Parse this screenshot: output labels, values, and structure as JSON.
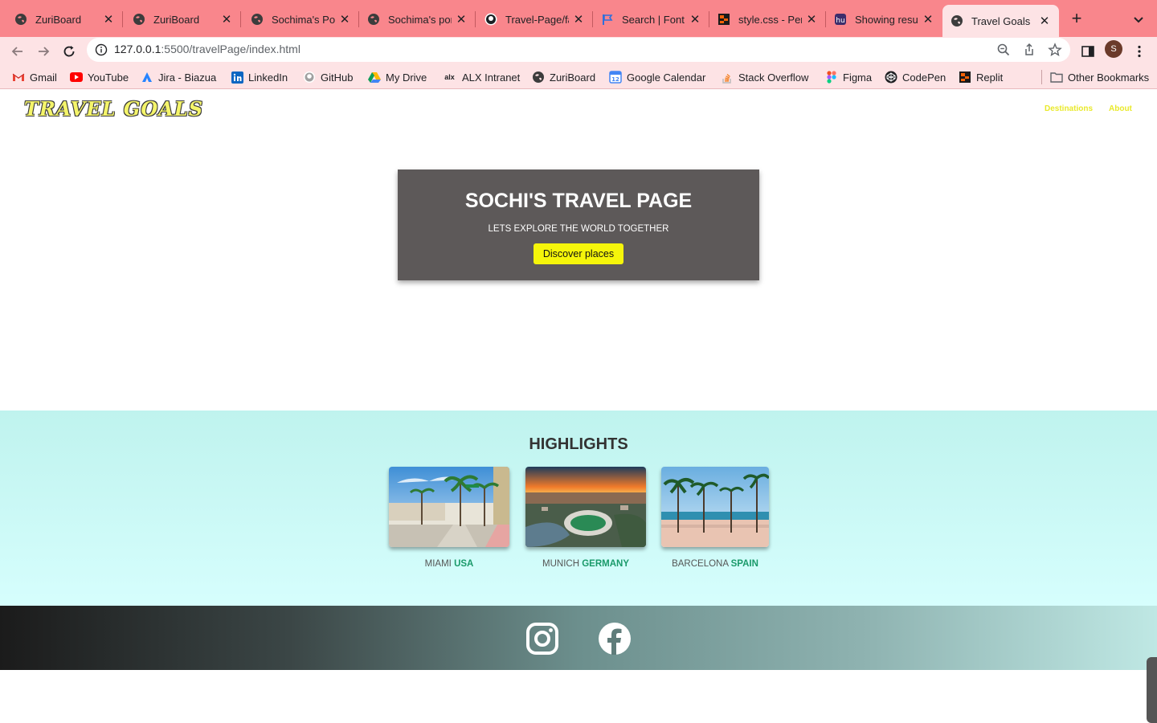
{
  "browser": {
    "tabs": [
      {
        "title": "ZuriBoard",
        "icon": "globe-icon",
        "active": false
      },
      {
        "title": "ZuriBoard",
        "icon": "globe-icon",
        "active": false
      },
      {
        "title": "Sochima's Por",
        "icon": "globe-icon",
        "active": false
      },
      {
        "title": "Sochima's por",
        "icon": "globe-icon",
        "active": false
      },
      {
        "title": "Travel-Page/fa",
        "icon": "github-icon",
        "active": false
      },
      {
        "title": "Search | Font ",
        "icon": "flag-icon",
        "active": false
      },
      {
        "title": "style.css - Per",
        "icon": "replit-icon",
        "active": false
      },
      {
        "title": "Showing resul",
        "icon": "hu-icon",
        "active": false
      },
      {
        "title": "Travel Goals",
        "icon": "globe-icon",
        "active": true
      }
    ],
    "url_host": "127.0.0.1",
    "url_rest": ":5500/travelPage/index.html",
    "profile_initial": "S",
    "bookmarks": [
      {
        "label": "Gmail",
        "icon": "gmail-icon"
      },
      {
        "label": "YouTube",
        "icon": "youtube-icon"
      },
      {
        "label": "Jira - Biazua",
        "icon": "jira-icon"
      },
      {
        "label": "LinkedIn",
        "icon": "linkedin-icon"
      },
      {
        "label": "GitHub",
        "icon": "github-icon"
      },
      {
        "label": "My Drive",
        "icon": "drive-icon"
      },
      {
        "label": "ALX Intranet",
        "icon": "alx-icon"
      },
      {
        "label": "ZuriBoard",
        "icon": "globe-icon"
      },
      {
        "label": "Google Calendar",
        "icon": "calendar-icon"
      },
      {
        "label": "Stack Overflow",
        "icon": "stackoverflow-icon"
      },
      {
        "label": "Figma",
        "icon": "figma-icon"
      },
      {
        "label": "CodePen",
        "icon": "codepen-icon"
      },
      {
        "label": "Replit",
        "icon": "replit-icon"
      }
    ],
    "other_bookmarks": "Other Bookmarks"
  },
  "page": {
    "logo": "TRAVEL GOALS",
    "nav": [
      "Destinations",
      "About"
    ],
    "hero": {
      "title": "SOCHI'S TRAVEL PAGE",
      "subtitle": "LETS EXPLORE THE WORLD TOGETHER",
      "button": "Discover places"
    },
    "highlights": {
      "title": "HIGHLIGHTS",
      "items": [
        {
          "city": "MIAMI",
          "country": "USA"
        },
        {
          "city": "MUNICH",
          "country": "GERMANY"
        },
        {
          "city": "BARCELONA",
          "country": "SPAIN"
        }
      ]
    },
    "footer": {
      "social": [
        "instagram-icon",
        "facebook-icon"
      ]
    }
  },
  "colors": {
    "tab_strip": "#f9868c",
    "toolbar": "#fde3e5",
    "hero_bg": "#5d5959",
    "button_yellow": "#f5f50a",
    "highlight_bg": "#c8f8f4",
    "country_green": "#1a9a6a"
  }
}
